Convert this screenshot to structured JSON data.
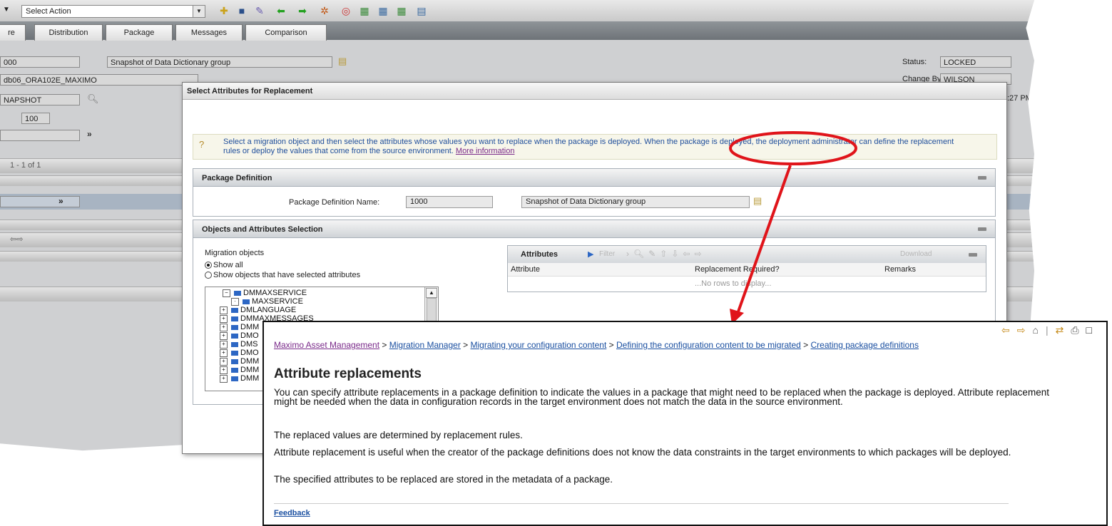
{
  "toolbar": {
    "select_action": "Select Action"
  },
  "tabs": [
    "re",
    "Distribution",
    "Package",
    "Messages",
    "Comparison"
  ],
  "background_form": {
    "id_value": "000",
    "description_value": "Snapshot of Data Dictionary group",
    "source_value": "db06_ORA102E_MAXIMO",
    "type_value": "NAPSHOT",
    "number_value": "100",
    "status_label": "Status:",
    "status_value": "LOCKED",
    "change_by_label": "Change By:",
    "change_by_value": "WILSON",
    "time_fragment": ":27 PM",
    "pager_text": "1 - 1 of 1"
  },
  "dialog": {
    "title": "Select Attributes for Replacement",
    "info_text": "Select a migration object and then select the attributes whose values you want to replace when the package is deployed. When the package is deployed, the deployment administrator can define the replacement rules or deploy the values that come from the source environment.",
    "more_info_link": "More information",
    "package_definition": {
      "header": "Package Definition",
      "name_label": "Package Definition Name:",
      "name_value": "1000",
      "description_value": "Snapshot of Data Dictionary group"
    },
    "selection": {
      "header": "Objects and Attributes Selection",
      "migration_objects_label": "Migration objects",
      "radio_show_all": "Show all",
      "radio_show_selected": "Show objects that have selected attributes",
      "tree_items": [
        "DMMAXSERVICE",
        "MAXSERVICE",
        "DMLANGUAGE",
        "DMMAXMESSAGES",
        "DMM",
        "DMO",
        "DMS",
        "DMO",
        "DMM",
        "DMM",
        "DMM"
      ]
    },
    "attributes_table": {
      "title": "Attributes",
      "filter_label": "Filter",
      "download_label": "Download",
      "columns": [
        "Attribute",
        "Replacement Required?",
        "Remarks"
      ],
      "empty_text": "...No rows to display..."
    }
  },
  "help": {
    "breadcrumb": [
      "Maximo Asset Management",
      "Migration Manager",
      "Migrating your configuration content",
      "Defining the configuration content to be migrated",
      "Creating package definitions"
    ],
    "title": "Attribute replacements",
    "paragraphs": [
      "You can specify attribute replacements in a package definition to indicate the values in a package that might need to be replaced when the package is deployed. Attribute replacement might be needed when the data in configuration records in the target environment does not match the data in the source environment.",
      "The replaced values are determined by replacement rules.",
      "Attribute replacement is useful when the creator of the package definitions does not know the data constraints in the target environments to which packages will be deployed.",
      "The specified attributes to be replaced are stored in the metadata of a package."
    ],
    "feedback_link": "Feedback"
  },
  "colors": {
    "highlight": "#e0141a",
    "link": "#1a4fa0",
    "section_header": "#cfd3d7"
  }
}
